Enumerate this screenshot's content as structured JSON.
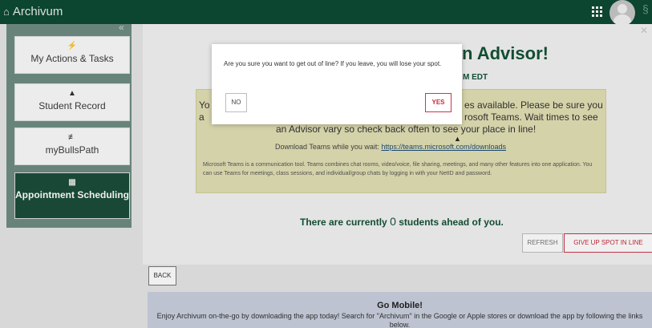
{
  "app": {
    "title": "Archivum",
    "home_icon": "home-icon"
  },
  "topbar": {
    "apps_icon": "grid-icon",
    "avatar_icon": "user-avatar"
  },
  "sidebar": {
    "collapse_label": "«",
    "items": [
      {
        "label": "My Actions & Tasks",
        "icon": "bolt-icon",
        "glyph": "⚡"
      },
      {
        "label": "Student Record",
        "icon": "person-icon",
        "glyph": "▲"
      },
      {
        "label": "myBullsPath",
        "icon": "signpost-icon",
        "glyph": "≢"
      },
      {
        "label": "Appointment Scheduling",
        "icon": "calendar-icon",
        "glyph": "▦",
        "active": true
      }
    ]
  },
  "main": {
    "heading_fragment": "n Advisor!",
    "time_fragment": "M EDT",
    "notice": {
      "line1_left": "Yo",
      "line1_right": "es available. Please be sure you",
      "line2_left": "a",
      "line2_right": "rosoft Teams. Wait times to see",
      "line3": "an Advisor vary so check back often to see your place in line!",
      "download_text": "Download Teams while you wait:",
      "download_link": "https://teams.microsoft.com/downloads",
      "teams_info": "Microsoft Teams is a communication tool. Teams combines chat rooms, video/voice, file sharing, meetings, and many other features into one application. You can use Teams for meetings, class sessions, and individual/group chats by logging in with your NetID and password."
    },
    "queue": {
      "before": "There are currently",
      "count": "0",
      "after": "students ahead of you."
    },
    "buttons": {
      "refresh": "REFRESH",
      "give_up": "GIVE UP SPOT IN LINE",
      "back": "BACK"
    },
    "mobile": {
      "title": "Go Mobile!",
      "text": "Enjoy Archivum on-the-go by downloading the app today! Search for \"Archivum\" in the Google or Apple stores or download the app by following the links below."
    }
  },
  "modal": {
    "message": "Are you sure you want to get out of line? If you leave, you will lose your spot.",
    "no_label": "NO",
    "yes_label": "YES"
  },
  "colors": {
    "brand_green": "#0d4a33",
    "accent_red": "#c8283d",
    "notice_bg": "#e2e0b4"
  }
}
